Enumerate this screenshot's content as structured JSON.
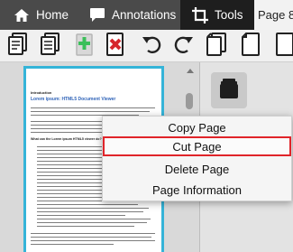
{
  "tabs": {
    "home": "Home",
    "annotations": "Annotations",
    "tools": "Tools"
  },
  "page_indicator": "Page 8",
  "document": {
    "heading": "Introduction",
    "title": "Lorem ipsum: HTML5 Document Viewer",
    "subtitle": "What can the Lorem ipsum HTML5 viewer do?"
  },
  "context_menu": {
    "items": [
      "Copy Page",
      "Cut Page",
      "Delete Page",
      "Page Information"
    ]
  },
  "colors": {
    "tab_bar": "#4a4a4a",
    "active_tab": "#1e1e1e",
    "selection_border": "#35b4d8",
    "highlight": "#e0242a"
  }
}
